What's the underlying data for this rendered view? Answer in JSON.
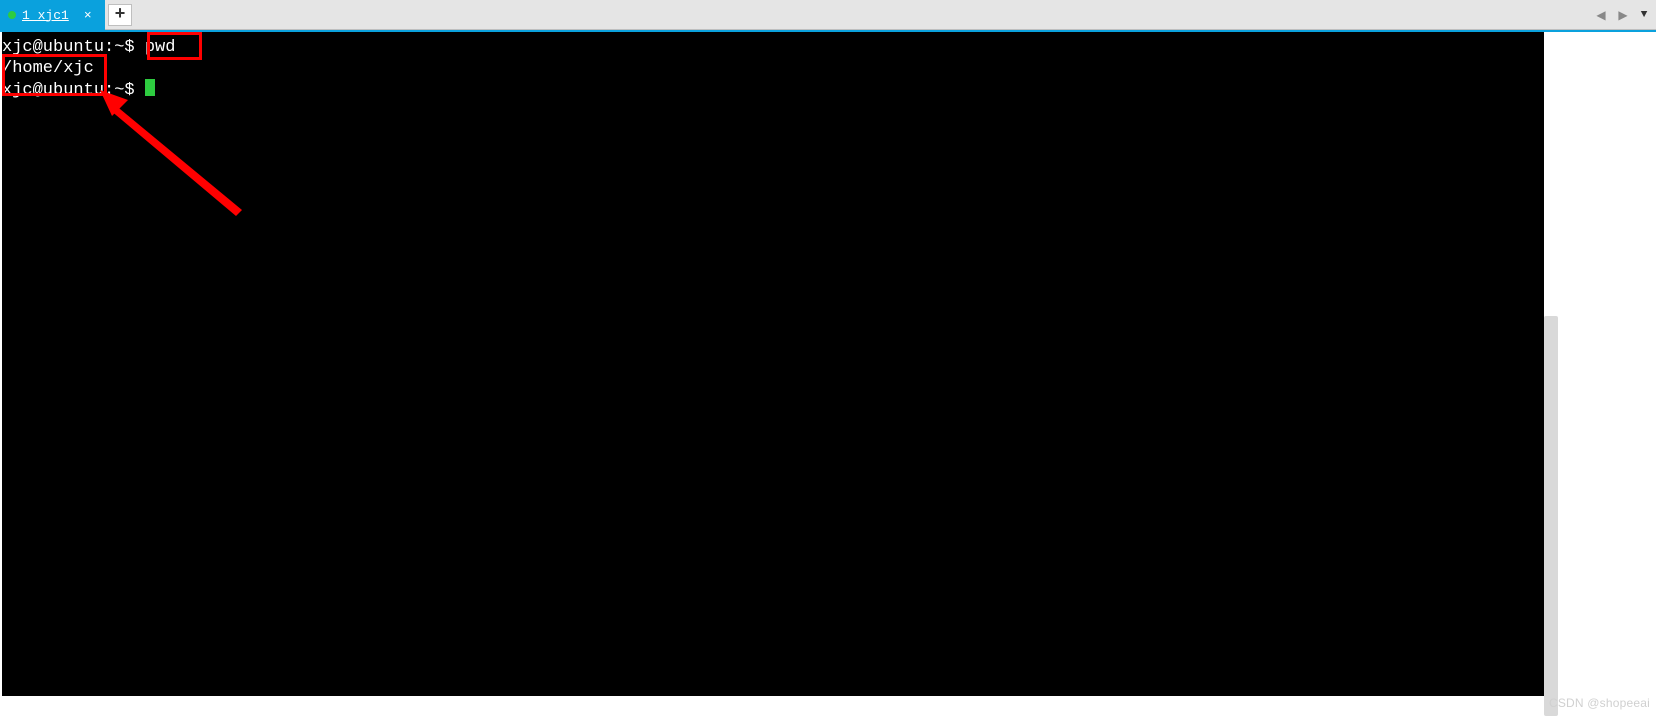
{
  "tabbar": {
    "tabs": [
      {
        "label": "1 xjc1",
        "active": true
      }
    ],
    "newtab_symbol": "+",
    "nav": {
      "prev_enabled": false,
      "next_enabled": false
    }
  },
  "terminal": {
    "lines": [
      {
        "prompt": "xjc@ubuntu:~$",
        "command": "pwd"
      },
      {
        "output": "/home/xjc"
      },
      {
        "prompt": "xjc@ubuntu:~$",
        "command": "",
        "cursor": true
      }
    ]
  },
  "annotations": {
    "highlight_boxes": [
      "command-pwd",
      "output-home-xjc"
    ],
    "arrow": true
  },
  "watermark": "CSDN @shopeeai"
}
